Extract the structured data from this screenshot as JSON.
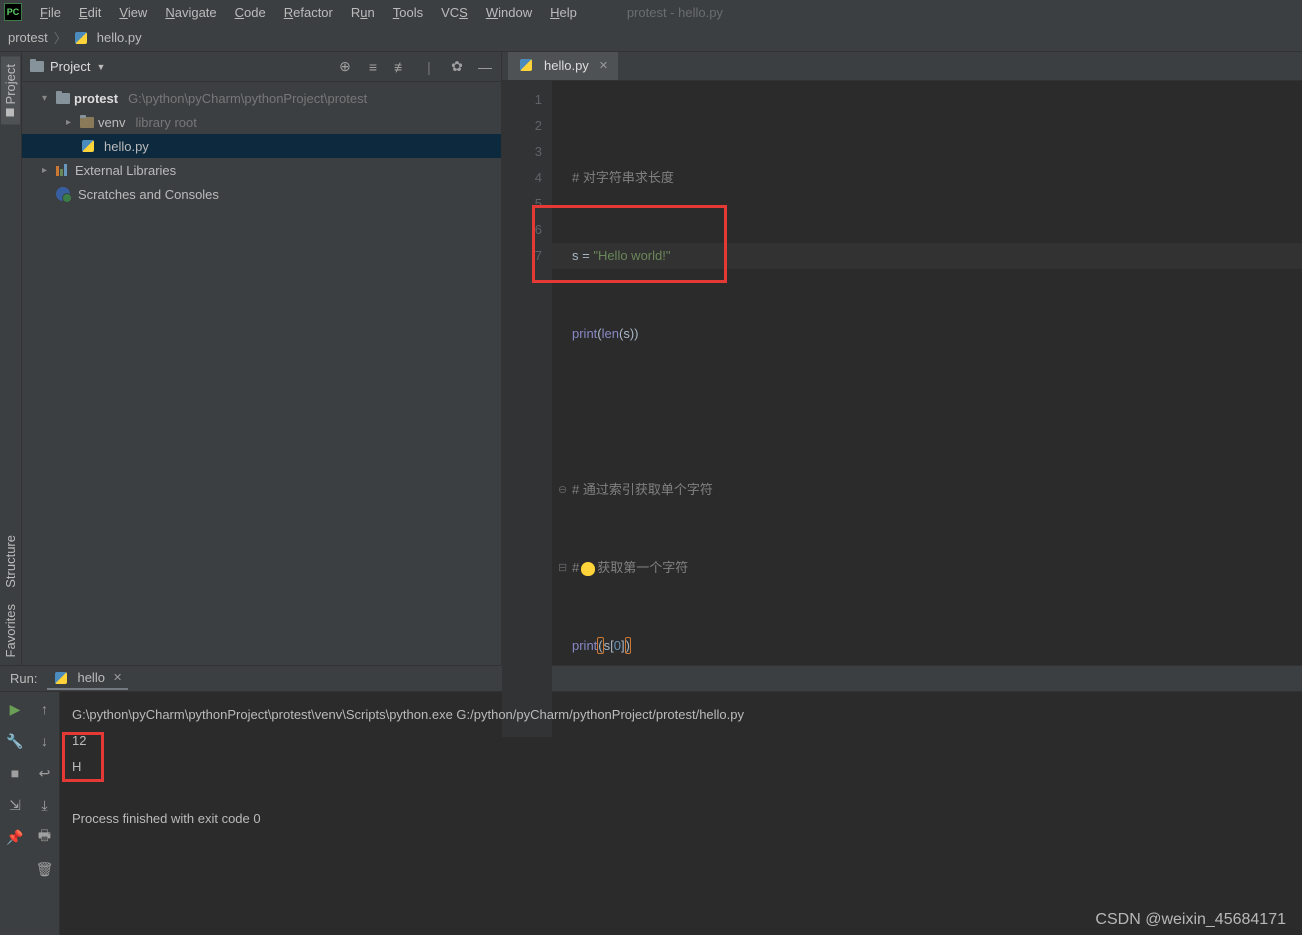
{
  "window_title": "protest - hello.py",
  "menu": [
    "File",
    "Edit",
    "View",
    "Navigate",
    "Code",
    "Refactor",
    "Run",
    "Tools",
    "VCS",
    "Window",
    "Help"
  ],
  "breadcrumb": {
    "project": "protest",
    "file": "hello.py"
  },
  "project_panel": {
    "title": "Project",
    "root_name": "protest",
    "root_path": "G:\\python\\pyCharm\\pythonProject\\protest",
    "venv": "venv",
    "venv_tag": "library root",
    "file": "hello.py",
    "ext_libs": "External Libraries",
    "scratches": "Scratches and Consoles"
  },
  "editor_tab": "hello.py",
  "code": {
    "l1_c": "# 对字符串求长度",
    "l2_a": "s = ",
    "l2_b": "\"Hello world!\"",
    "l3_a": "print",
    "l3_b": "(",
    "l3_c": "len",
    "l3_d": "(s))",
    "l5_c": "# 通过索引获取单个字符",
    "l6_c": "获取第一个字符",
    "l7_a": "print",
    "l7_b": "(",
    "l7_c": "s[",
    "l7_d": "0",
    "l7_e": "]",
    "l7_f": ")"
  },
  "line_numbers": [
    "1",
    "2",
    "3",
    "4",
    "5",
    "6",
    "7"
  ],
  "run": {
    "label": "Run:",
    "config": "hello",
    "out_cmd": "G:\\python\\pyCharm\\pythonProject\\protest\\venv\\Scripts\\python.exe G:/python/pyCharm/pythonProject/protest/hello.py",
    "out_1": "12",
    "out_2": "H",
    "exit": "Process finished with exit code 0"
  },
  "sidebars": {
    "project": "Project",
    "structure": "Structure",
    "favorites": "Favorites"
  },
  "watermark": "CSDN @weixin_45684171"
}
